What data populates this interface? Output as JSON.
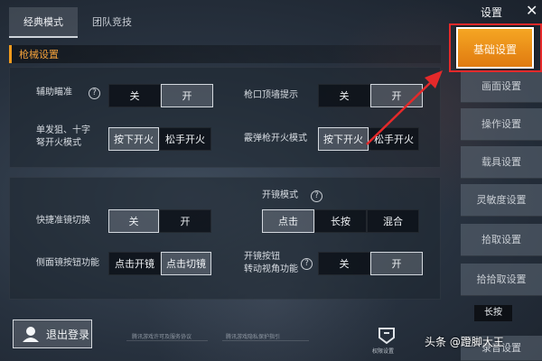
{
  "tabs": [
    {
      "label": "经典模式",
      "active": true
    },
    {
      "label": "团队竞技",
      "active": false
    }
  ],
  "section": {
    "title": "枪械设置"
  },
  "rows": {
    "aim_assist": {
      "label": "辅助瞄准",
      "off": "关",
      "on": "开",
      "selected": "on"
    },
    "muzzle_hint": {
      "label": "枪口顶墙提示",
      "off": "关",
      "on": "开",
      "selected": "on"
    },
    "sniper_fire": {
      "line1": "单发狙、十字",
      "line2": "弩开火模式",
      "opt1": "按下开火",
      "opt2": "松手开火",
      "selected": "opt1"
    },
    "shotgun_fire": {
      "label": "霰弹枪开火模式",
      "opt1": "按下开火",
      "opt2": "松手开火",
      "selected": "opt1"
    },
    "quick_scope": {
      "label": "快捷准镜切换",
      "off": "关",
      "on": "开",
      "selected": "off"
    },
    "scope_mode": {
      "label": "开镜模式",
      "opt1": "点击",
      "opt2": "长按",
      "opt3": "混合",
      "selected": "opt1"
    },
    "side_scope": {
      "label": "侧面镜按钮功能",
      "opt1": "点击开镜",
      "opt2": "点击切镜",
      "selected": "opt2"
    },
    "scope_turn": {
      "line1": "开镜按钮",
      "line2": "转动视角功能",
      "off": "关",
      "on": "开",
      "selected": "on"
    }
  },
  "nav": {
    "title": "设置",
    "items": [
      "基础设置",
      "画面设置",
      "操作设置",
      "载具设置",
      "灵敏度设置",
      "拾取设置",
      "拾拾取设置",
      "录音设置"
    ],
    "active_index": 0,
    "badge": "长按"
  },
  "footer": {
    "logout": "退出登录",
    "link1": "腾讯游戏许可及服务协议",
    "link2": "腾讯游戏隐私保护指引",
    "privacy": "权限设置"
  },
  "watermark": "头条 @蹬脚大王",
  "colors": {
    "accent": "#f29b1d",
    "annotation": "#e4292a"
  }
}
